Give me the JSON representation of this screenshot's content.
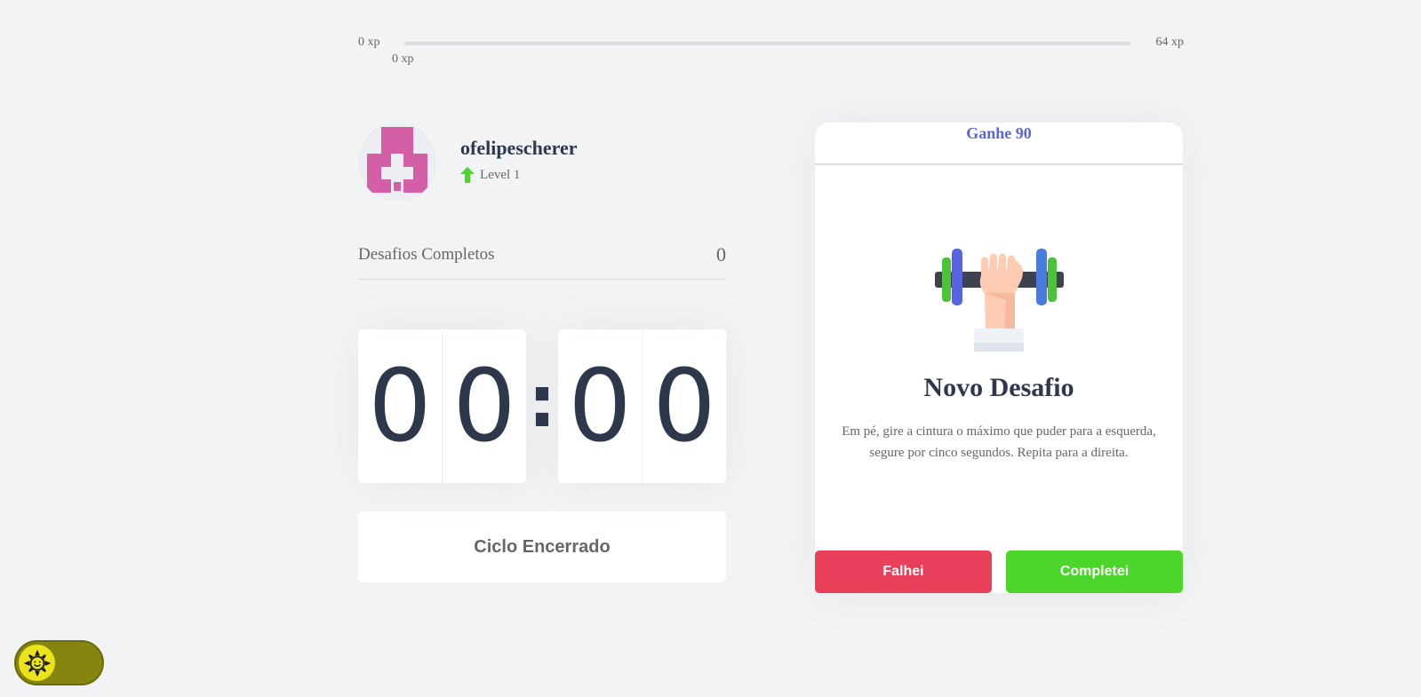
{
  "xp": {
    "min_label": "0 xp",
    "max_label": "64 xp",
    "current_label": "0 xp",
    "progress": 0
  },
  "profile": {
    "username": "ofelipescherer",
    "level_label": "Level 1"
  },
  "stats": {
    "completed_label": "Desafios Completos",
    "completed_count": "0"
  },
  "countdown": {
    "minute_left": "0",
    "minute_right": "0",
    "separator": ":",
    "second_left": "0",
    "second_right": "0"
  },
  "cycle_button_label": "Ciclo Encerrado",
  "challenge": {
    "reward": "Ganhe 90",
    "title": "Novo Desafio",
    "description": "Em pé, gire a cintura o máximo que puder para a esquerda, segure por cinco segundos. Repita para a direita.",
    "fail_label": "Falhei",
    "success_label": "Completei"
  },
  "colors": {
    "background": "#f2f3f5",
    "title": "#2e384d",
    "text": "#666666",
    "accent": "#5965e0",
    "red": "#e83f5b",
    "green": "#4cd62b",
    "toggle_track": "#85860f",
    "toggle_knob": "#ebe31b"
  },
  "icons": {
    "level": "arrow-up-icon",
    "challenge": "dumbbell-body-icon",
    "theme": "sun-icon"
  }
}
